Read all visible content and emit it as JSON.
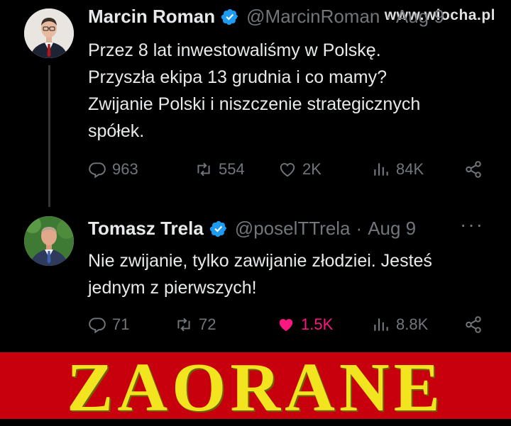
{
  "watermark": "www.wiocha.pl",
  "tweets": [
    {
      "name": "Marcin Roman",
      "handle": "@MarcinRoman",
      "handle_suffix": "· Aug 9",
      "text_lines": [
        "Przez 8 lat inwestowaliśmy w Polskę.",
        "Przyszła ekipa 13 grudnia i co mamy?",
        "Zwijanie Polski i niszczenie strategicznych",
        "spółek."
      ],
      "stats": {
        "replies": "963",
        "reposts": "554",
        "likes": "2K",
        "views": "84K"
      },
      "liked": false
    },
    {
      "name": "Tomasz Trela",
      "handle": "@poselTTrela",
      "separator": "·",
      "date": "Aug 9",
      "more": "···",
      "text_lines": [
        "Nie zwijanie, tylko zawijanie złodziei. Jesteś",
        "jednym z pierwszych!"
      ],
      "stats": {
        "replies": "71",
        "reposts": "72",
        "likes": "1.5K",
        "views": "8.8K"
      },
      "liked": true
    }
  ],
  "banner": {
    "text": "ZAORANE"
  },
  "colors": {
    "background": "#000000",
    "text": "#e7e9ea",
    "muted": "#71767b",
    "verified": "#1d9bf0",
    "like_active": "#f91880",
    "banner_bg": "#c8000e",
    "banner_text": "#f2e520"
  },
  "icons": [
    "verified-badge-icon",
    "reply-icon",
    "repost-icon",
    "like-icon",
    "views-icon",
    "share-icon"
  ]
}
